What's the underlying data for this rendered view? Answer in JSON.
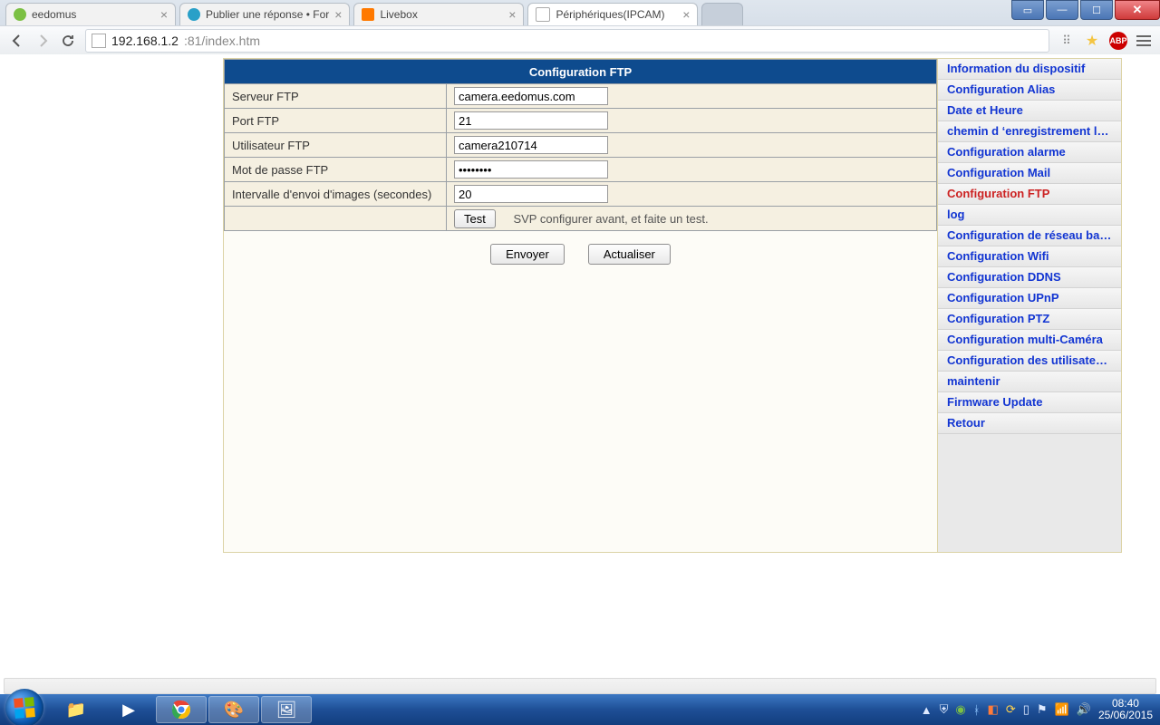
{
  "browser": {
    "tabs": [
      {
        "label": "eedomus",
        "favColor": "#7bc043"
      },
      {
        "label": "Publier une réponse • For",
        "favColor": "#2aa0c8"
      },
      {
        "label": "Livebox",
        "favColor": "#ff7900"
      },
      {
        "label": "Périphériques(IPCAM)",
        "favColor": "#ffffff",
        "active": true
      }
    ],
    "url_host": "192.168.1.2",
    "url_rest": ":81/index.htm",
    "abp": "ABP"
  },
  "ftp": {
    "title": "Configuration FTP",
    "rows": {
      "server_label": "Serveur FTP",
      "server": "camera.eedomus.com",
      "port_label": "Port FTP",
      "port": "21",
      "user_label": "Utilisateur FTP",
      "user": "camera210714",
      "pass_label": "Mot de passe FTP",
      "pass": "••••••••",
      "interval_label": "Intervalle d'envoi d'images (secondes)",
      "interval": "20",
      "test_btn": "Test",
      "test_hint": "SVP configurer avant, et faite un test."
    },
    "submit": "Envoyer",
    "refresh": "Actualiser"
  },
  "side": {
    "items": [
      "Information du dispositif",
      "Configuration Alias",
      "Date et Heure",
      "chemin d ‘enregistrement local",
      "Configuration alarme",
      "Configuration Mail",
      "Configuration FTP",
      "log",
      "Configuration de réseau basique",
      "Configuration Wifi",
      "Configuration DDNS",
      "Configuration UPnP",
      "Configuration PTZ",
      "Configuration multi-Caméra",
      "Configuration des utilisateurs",
      "maintenir",
      "Firmware Update",
      "Retour"
    ],
    "active_index": 6
  },
  "taskbar": {
    "time": "08:40",
    "date": "25/06/2015"
  }
}
